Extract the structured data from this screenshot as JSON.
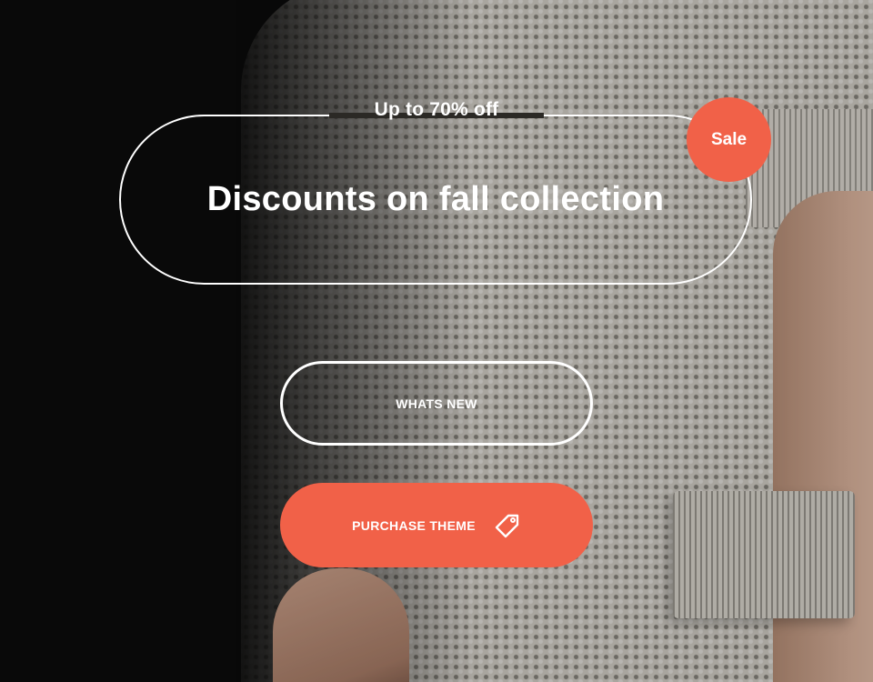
{
  "hero": {
    "eyebrow": "Up to 70% off",
    "headline": "Discounts on fall collection",
    "sale_badge": "Sale"
  },
  "buttons": {
    "whats_new_label": "WHATS NEW",
    "purchase_label": "PURCHASE THEME",
    "purchase_icon": "price-tag-icon"
  },
  "colors": {
    "accent": "#f16148",
    "text": "#ffffff"
  }
}
